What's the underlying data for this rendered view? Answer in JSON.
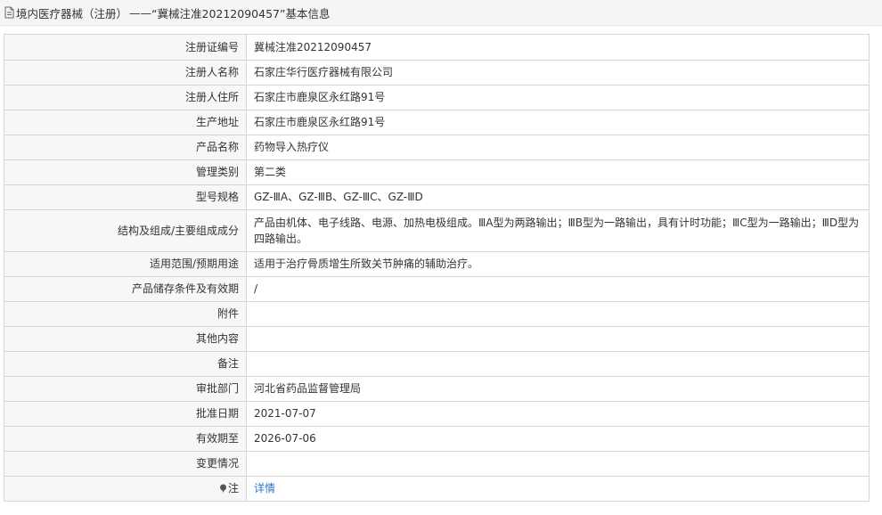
{
  "header": {
    "category": "境内医疗器械（注册）",
    "dash": "——",
    "quote_number": "“冀械注准20212090457”",
    "suffix": "基本信息"
  },
  "rows": [
    {
      "label": "注册证编号",
      "value": "冀械注准20212090457"
    },
    {
      "label": "注册人名称",
      "value": "石家庄华行医疗器械有限公司"
    },
    {
      "label": "注册人住所",
      "value": "石家庄市鹿泉区永红路91号"
    },
    {
      "label": "生产地址",
      "value": "石家庄市鹿泉区永红路91号"
    },
    {
      "label": "产品名称",
      "value": "药物导入热疗仪"
    },
    {
      "label": "管理类别",
      "value": "第二类"
    },
    {
      "label": "型号规格",
      "value": "GZ-ⅢA、GZ-ⅢB、GZ-ⅢC、GZ-ⅢD"
    },
    {
      "label": "结构及组成/主要组成成分",
      "value": "产品由机体、电子线路、电源、加热电极组成。ⅢA型为两路输出；ⅢB型为一路输出，具有计时功能；ⅢC型为一路输出；ⅢD型为四路输出。"
    },
    {
      "label": "适用范围/预期用途",
      "value": "适用于治疗骨质增生所致关节肿痛的辅助治疗。"
    },
    {
      "label": "产品储存条件及有效期",
      "value": "/"
    },
    {
      "label": "附件",
      "value": ""
    },
    {
      "label": "其他内容",
      "value": ""
    },
    {
      "label": "备注",
      "value": ""
    },
    {
      "label": "审批部门",
      "value": "河北省药品监督管理局"
    },
    {
      "label": "批准日期",
      "value": "2021-07-07"
    },
    {
      "label": "有效期至",
      "value": "2026-07-06"
    },
    {
      "label": "变更情况",
      "value": ""
    }
  ],
  "note_row": {
    "label": "注",
    "link_text": "详情"
  },
  "colors": {
    "link": "#2a73c7",
    "label_bg": "#f7f7f7",
    "border": "#d6d6d6",
    "header_bg": "#f5f5f5"
  },
  "icons": {
    "header_icon": "document-icon",
    "note_icon": "pin-icon"
  }
}
